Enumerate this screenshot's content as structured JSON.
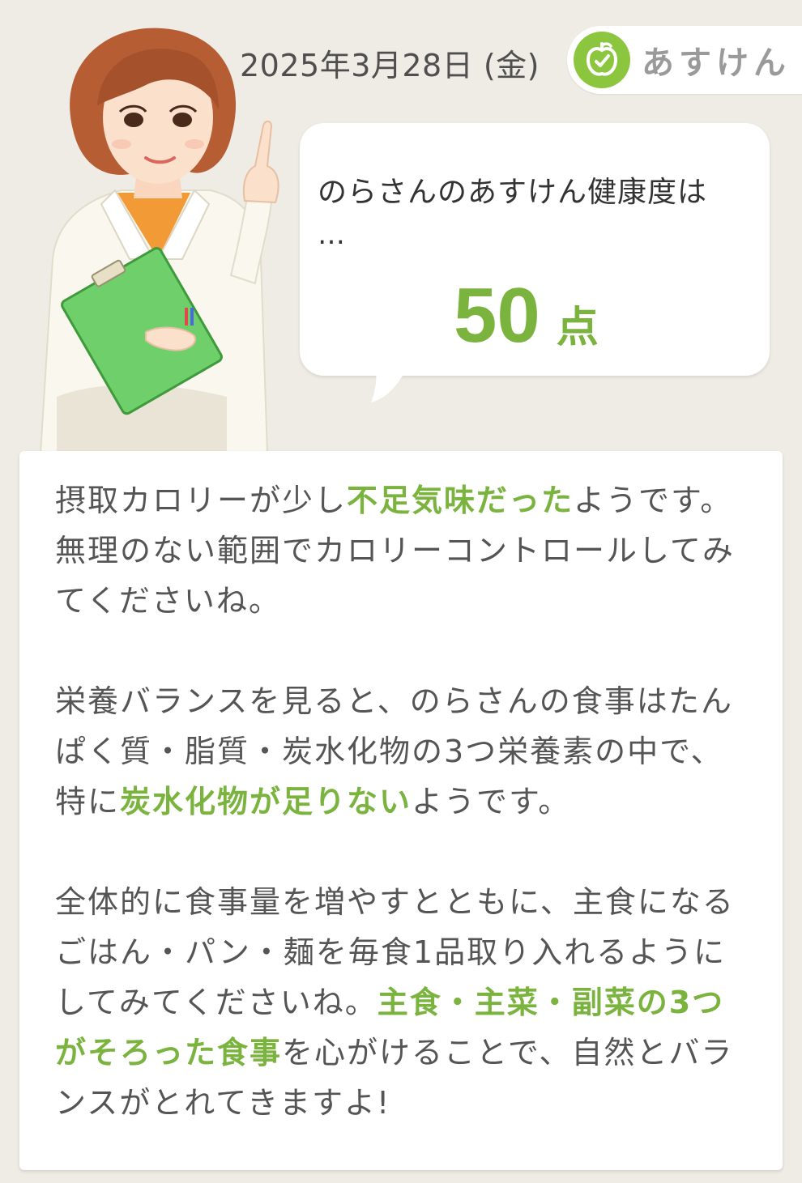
{
  "header": {
    "date": "2025年3月28日 (金)",
    "brand_name": "あすけん",
    "brand_icon": "apple-icon",
    "accent_color": "#7ab33e"
  },
  "bubble": {
    "intro": "のらさんのあすけん健康度は",
    "ellipsis": "…",
    "score": "50",
    "score_unit": "点"
  },
  "advice": {
    "p1": {
      "before": "摂取カロリーが少し",
      "highlight": "不足気味だった",
      "after": "ようです。無理のない範囲でカロリーコントロールしてみてくださいね。"
    },
    "p2": {
      "before": "栄養バランスを見ると、のらさんの食事はたんぱく質・脂質・炭水化物の3つ栄養素の中で、特に",
      "highlight": "炭水化物が足りない",
      "after": "ようです。"
    },
    "p3": {
      "before": "全体的に食事量を増やすとともに、主食になるごはん・パン・麺を毎食1品取り入れるようにしてみてくださいね。",
      "highlight": "主食・主菜・副菜の3つがそろった食事",
      "after": "を心がけることで、自然とバランスがとれてきますよ!"
    }
  }
}
